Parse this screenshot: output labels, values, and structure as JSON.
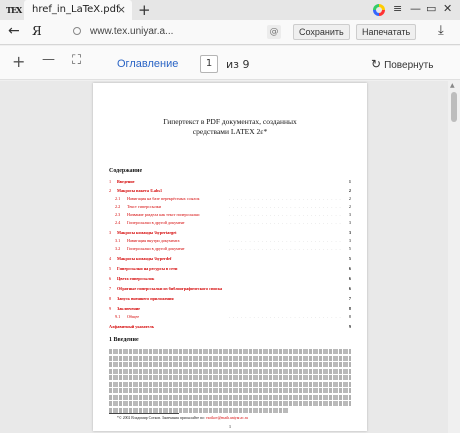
{
  "browser": {
    "favicon": "TEX",
    "tab_title": "href_in_LaTeX.pdf",
    "tab_close": "×",
    "new_tab": "+",
    "window_controls": {
      "menu": "≡",
      "minimize": "—",
      "maximize": "▭",
      "close": "✕"
    },
    "back": "←",
    "yandex_logo": "Я",
    "url": "www.tex.uniyar.a...",
    "protect_icon": "@",
    "save_label": "Сохранить",
    "print_label": "Напечатать",
    "download": "⤓"
  },
  "pdf_toolbar": {
    "zoom_in": "+",
    "zoom_out": "—",
    "fit": "⛶",
    "toc_label": "Оглавление",
    "current_page": "1",
    "page_of": "из 9",
    "rotate_icon": "↻",
    "rotate_label": "Повернуть"
  },
  "document": {
    "title_line1": "Гипертекст в PDF документах, созданных",
    "title_line2": "средствами LATEX 2ε*",
    "toc_heading": "Содержание",
    "toc": [
      {
        "num": "1",
        "text": "Введение",
        "page": "1",
        "level": 0
      },
      {
        "num": "2",
        "text": "Макросы пакета \\Lahs1",
        "page": "2",
        "level": 0
      },
      {
        "num": "2.1",
        "text": "Навигация на базе перекрёстных ссылок",
        "page": "2",
        "level": 1
      },
      {
        "num": "2.2",
        "text": "Текст гиперссылки",
        "page": "2",
        "level": 1
      },
      {
        "num": "2.3",
        "text": "Название раздела как текст гиперссылки",
        "page": "3",
        "level": 1
      },
      {
        "num": "2.4",
        "text": "Гиперссылки в другой документ",
        "page": "3",
        "level": 1
      },
      {
        "num": "3",
        "text": "Макросы команды \\hypertarget",
        "page": "3",
        "level": 0
      },
      {
        "num": "3.1",
        "text": "Навигация внутри документа",
        "page": "3",
        "level": 1
      },
      {
        "num": "3.2",
        "text": "Гиперссылки в другой документ",
        "page": "5",
        "level": 1
      },
      {
        "num": "4",
        "text": "Макросы команды \\hyperdef",
        "page": "5",
        "level": 0
      },
      {
        "num": "5",
        "text": "Гиперссылки на ресурсы в сети",
        "page": "6",
        "level": 0
      },
      {
        "num": "6",
        "text": "Цвета гиперссылок",
        "page": "6",
        "level": 0
      },
      {
        "num": "7",
        "text": "Обратные гиперссылки из библиографического списка",
        "page": "6",
        "level": 0
      },
      {
        "num": "8",
        "text": "Запуск внешнего приложения",
        "page": "7",
        "level": 0
      },
      {
        "num": "9",
        "text": "Заключение",
        "page": "8",
        "level": 0
      },
      {
        "num": "9.1",
        "text": "Общее",
        "page": "8",
        "level": 1
      },
      {
        "num": "",
        "text": "Алфавитный указатель",
        "page": "9",
        "level": 0
      }
    ],
    "section_heading": "1   Введение",
    "footnote_text": "*© 2002 Владимир Сотков. Замечания присылайте по: ",
    "footnote_link": "vsotkov@math.uniyar.ac.ru",
    "page_number": "1"
  },
  "colors": {
    "link_blue": "#2a64c5",
    "pdf_link_red": "#d40000"
  }
}
